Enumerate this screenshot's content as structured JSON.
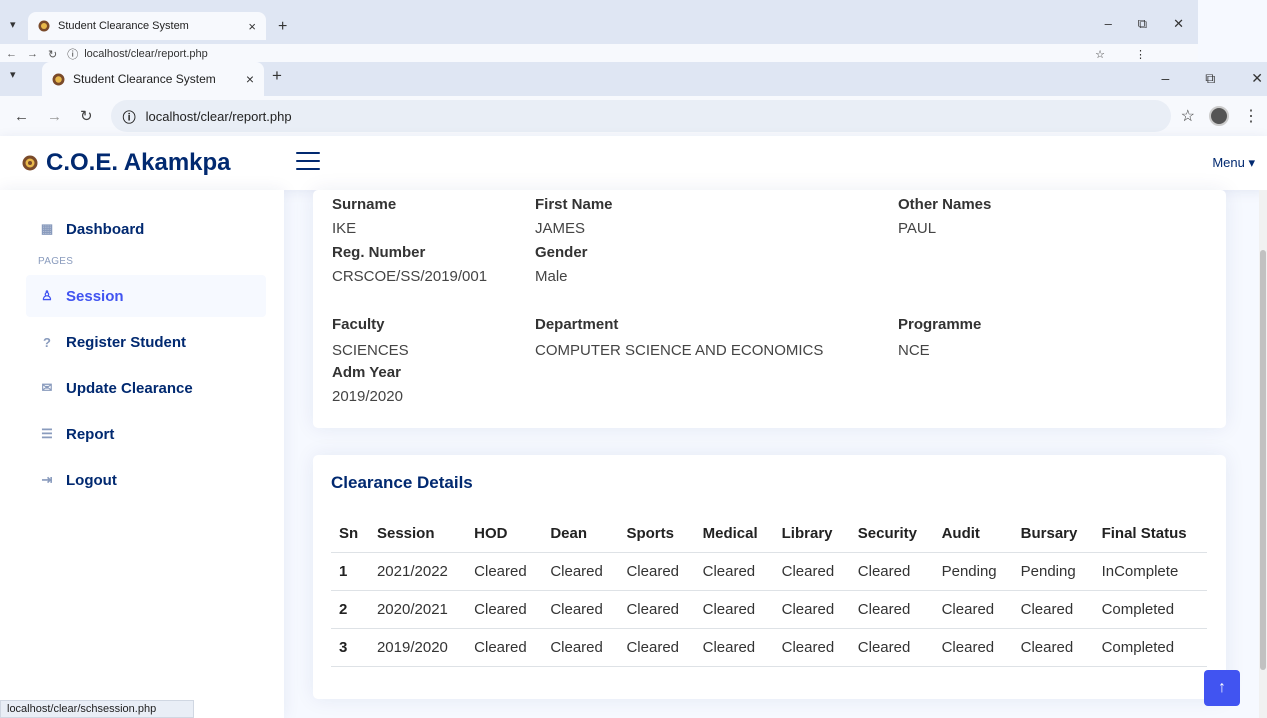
{
  "browser_back": {
    "tab_title": "Student Clearance System",
    "url": "localhost/clear/report.php",
    "close": "×",
    "new_tab": "+",
    "min": "–",
    "restore": "⧉",
    "win_close": "✕"
  },
  "browser_front": {
    "tab_title": "Student Clearance System",
    "url": "localhost/clear/report.php",
    "close": "×",
    "new_tab": "+",
    "min": "–",
    "restore": "⧉",
    "win_close": "✕"
  },
  "header": {
    "logo_text": "C.O.E. Akamkpa",
    "menu_label": "Menu ▾"
  },
  "sidebar": {
    "dashboard": "Dashboard",
    "pages_heading": "PAGES",
    "items": [
      {
        "label": "Session",
        "icon": "person-icon"
      },
      {
        "label": "Register Student",
        "icon": "question-circle-icon"
      },
      {
        "label": "Update Clearance",
        "icon": "envelope-icon"
      },
      {
        "label": "Report",
        "icon": "list-icon"
      },
      {
        "label": "Logout",
        "icon": "logout-icon"
      }
    ]
  },
  "student": {
    "surname_label": "Surname",
    "surname": "IKE",
    "first_name_label": "First Name",
    "first_name": "JAMES",
    "other_names_label": "Other Names",
    "other_names": "PAUL",
    "reg_label": "Reg. Number",
    "reg_number": "CRSCOE/SS/2019/001",
    "gender_label": "Gender",
    "gender": "Male",
    "faculty_label": "Faculty",
    "faculty": "SCIENCES",
    "department_label": "Department",
    "department": "COMPUTER SCIENCE AND ECONOMICS",
    "programme_label": "Programme",
    "programme": "NCE",
    "adm_year_label": "Adm Year",
    "adm_year": "2019/2020"
  },
  "clearance": {
    "title": "Clearance Details",
    "columns": [
      "Sn",
      "Session",
      "HOD",
      "Dean",
      "Sports",
      "Medical",
      "Library",
      "Security",
      "Audit",
      "Bursary",
      "Final Status"
    ],
    "rows": [
      [
        "1",
        "2021/2022",
        "Cleared",
        "Cleared",
        "Cleared",
        "Cleared",
        "Cleared",
        "Cleared",
        "Pending",
        "Pending",
        "InComplete"
      ],
      [
        "2",
        "2020/2021",
        "Cleared",
        "Cleared",
        "Cleared",
        "Cleared",
        "Cleared",
        "Cleared",
        "Cleared",
        "Cleared",
        "Completed"
      ],
      [
        "3",
        "2019/2020",
        "Cleared",
        "Cleared",
        "Cleared",
        "Cleared",
        "Cleared",
        "Cleared",
        "Cleared",
        "Cleared",
        "Completed"
      ]
    ]
  },
  "status_bar": "localhost/clear/schsession.php",
  "colors": {
    "primary": "#4154f1",
    "navy": "#012970",
    "bg": "#f6f9ff"
  }
}
